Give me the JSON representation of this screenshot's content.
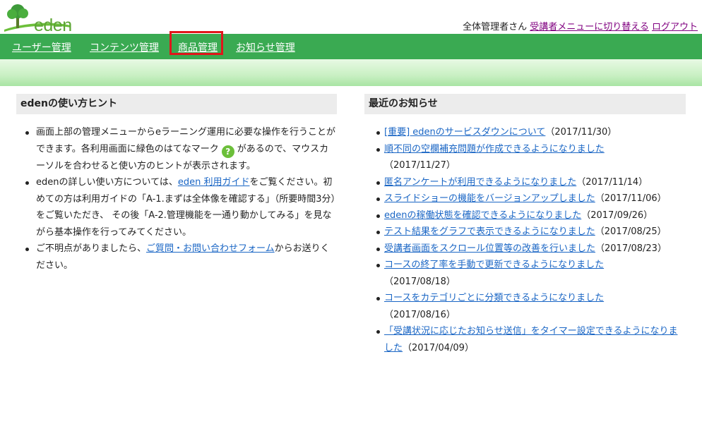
{
  "header": {
    "logo_text": "eden",
    "user_name": "全体管理者さん",
    "switch_menu_link": "受講者メニューに切り替える",
    "logout_link": "ログアウト"
  },
  "nav": {
    "items": [
      "ユーザー管理",
      "コンテンツ管理",
      "商品管理",
      "お知らせ管理"
    ],
    "highlighted_index": 2
  },
  "hints": {
    "title": "edenの使い方ヒント",
    "item1_a": "画面上部の管理メニューからeラーニング運用に必要な操作を行うことができます。各利用画面に緑色のはてなマーク",
    "help_icon_glyph": "?",
    "item1_b": "があるので、マウスカーソルを合わせると使い方のヒントが表示されます。",
    "item2_a": "edenの詳しい使い方については、",
    "item2_link": "eden 利用ガイド",
    "item2_b": "をご覧ください。初めての方は利用ガイドの「A-1.まずは全体像を確認する」（所要時間3分）をご覧いただき、 その後「A-2.管理機能を一通り動かしてみる」を見ながら基本操作を行ってみてください。",
    "item3_a": "ご不明点がありましたら、",
    "item3_link": "ご質問・お問い合わせフォーム",
    "item3_b": "からお送りください。"
  },
  "news": {
    "title": "最近のお知らせ",
    "items": [
      {
        "text": "[重要] edenのサービスダウンについて",
        "date": "（2017/11/30）"
      },
      {
        "text": "順不同の空欄補充問題が作成できるようになりました",
        "date": "（2017/11/27）"
      },
      {
        "text": "匿名アンケートが利用できるようになりました",
        "date": "（2017/11/14）"
      },
      {
        "text": "スライドショーの機能をバージョンアップしました",
        "date": "（2017/11/06）"
      },
      {
        "text": "edenの稼働状態を確認できるようになりました",
        "date": "（2017/09/26）"
      },
      {
        "text": "テスト結果をグラフで表示できるようになりました",
        "date": "（2017/08/25）"
      },
      {
        "text": "受講者画面をスクロール位置等の改善を行いました",
        "date": "（2017/08/23）"
      },
      {
        "text": "コースの終了率を手動で更新できるようになりました",
        "date": "（2017/08/18）"
      },
      {
        "text": "コースをカテゴリごとに分類できるようになりました",
        "date": "（2017/08/16）"
      },
      {
        "text": "「受講状況に応じたお知らせ送信」をタイマー設定できるようになりました",
        "date": "（2017/04/09）"
      }
    ]
  },
  "colors": {
    "nav_green": "#3aaa52",
    "link_blue": "#1a66c5",
    "highlight_red": "#e0161b",
    "help_green": "#6cbf3a"
  }
}
